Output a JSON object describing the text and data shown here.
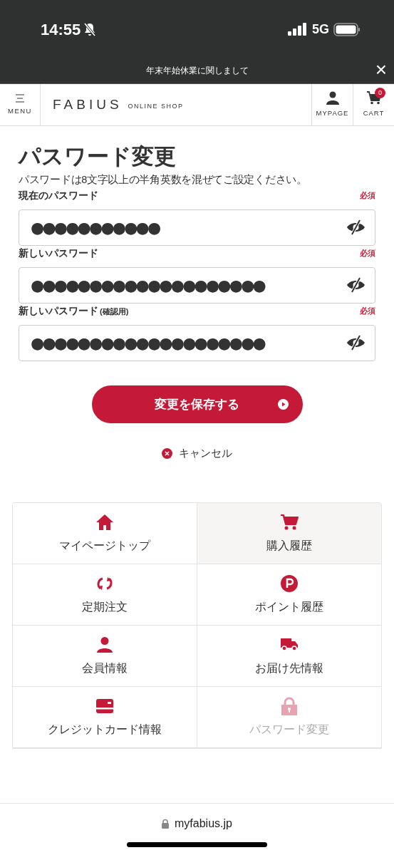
{
  "status_bar": {
    "time": "14:55",
    "network": "5G"
  },
  "announcement": {
    "text": "年末年始休業に関しまして",
    "close": "×"
  },
  "header": {
    "menu_label": "MENU",
    "logo": "FABIUS",
    "logo_sub": "ONLINE SHOP",
    "mypage_label": "MYPAGE",
    "cart_label": "CART",
    "cart_count": "0"
  },
  "page": {
    "title": "パスワード変更",
    "description": "パスワードは8文字以上の半角英数を混ぜてご設定ください。"
  },
  "fields": [
    {
      "label": "現在のパスワード",
      "required": "必須",
      "value": "●●●●●●●●●●●"
    },
    {
      "label": "新しいパスワード",
      "required": "必須",
      "value": "●●●●●●●●●●●●●●●●●●●●"
    },
    {
      "label": "新しいパスワード",
      "note": "(確認用)",
      "required": "必須",
      "value": "●●●●●●●●●●●●●●●●●●●●"
    }
  ],
  "save_button": "変更を保存する",
  "cancel_link": "キャンセル",
  "menu": [
    {
      "label": "マイページトップ",
      "kind": "home",
      "highlighted": false,
      "selected": false
    },
    {
      "label": "購入履歴",
      "kind": "cart",
      "highlighted": true,
      "selected": false
    },
    {
      "label": "定期注文",
      "kind": "cycle",
      "highlighted": false,
      "selected": false
    },
    {
      "label": "ポイント履歴",
      "kind": "points",
      "highlighted": false,
      "selected": false
    },
    {
      "label": "会員情報",
      "kind": "person",
      "highlighted": false,
      "selected": false
    },
    {
      "label": "お届け先情報",
      "kind": "truck",
      "highlighted": false,
      "selected": false
    },
    {
      "label": "クレジットカード情報",
      "kind": "card",
      "highlighted": false,
      "selected": false
    },
    {
      "label": "パスワード変更",
      "kind": "lock",
      "highlighted": false,
      "selected": true
    }
  ],
  "browser_bar": {
    "url": "myfabius.jp"
  }
}
